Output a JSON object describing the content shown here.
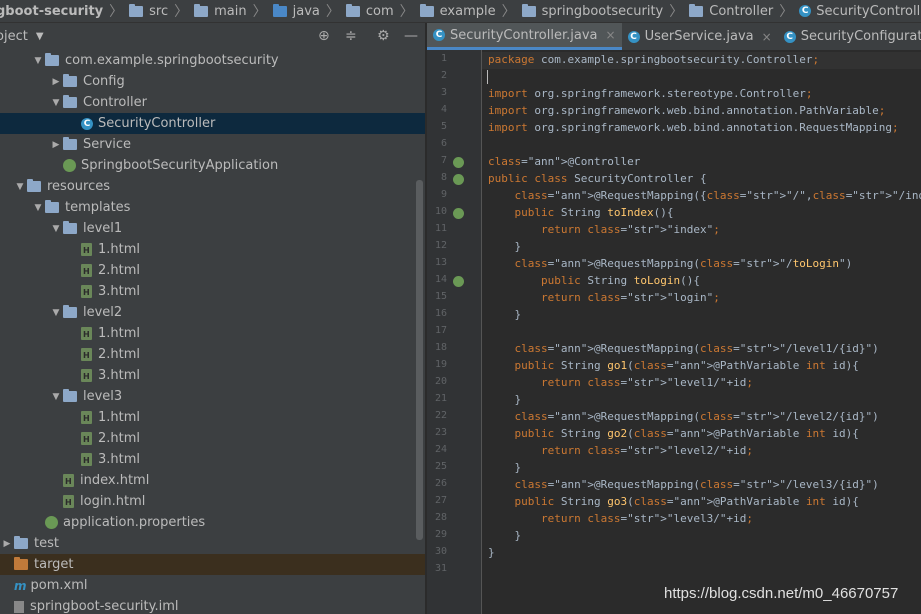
{
  "breadcrumb": {
    "project": "gboot-security",
    "items": [
      "src",
      "main",
      "java",
      "com",
      "example",
      "springbootsecurity",
      "Controller",
      "SecurityController"
    ]
  },
  "project_panel": {
    "title": "oject",
    "tools": [
      "target-icon",
      "collapse-icon",
      "gear-icon",
      "minimize-icon"
    ]
  },
  "tree": [
    {
      "label": "com.example.springbootsecurity",
      "indent": 2,
      "type": "package",
      "expanded": true
    },
    {
      "label": "Config",
      "indent": 3,
      "type": "package",
      "expanded": false
    },
    {
      "label": "Controller",
      "indent": 3,
      "type": "package",
      "expanded": true
    },
    {
      "label": "SecurityController",
      "indent": 4,
      "type": "class",
      "selected": true
    },
    {
      "label": "Service",
      "indent": 3,
      "type": "package",
      "expanded": false
    },
    {
      "label": "SpringbootSecurityApplication",
      "indent": 3,
      "type": "spring"
    },
    {
      "label": "resources",
      "indent": 1,
      "type": "resources",
      "expanded": true
    },
    {
      "label": "templates",
      "indent": 2,
      "type": "folder",
      "expanded": true
    },
    {
      "label": "level1",
      "indent": 3,
      "type": "folder",
      "expanded": true
    },
    {
      "label": "1.html",
      "indent": 4,
      "type": "html"
    },
    {
      "label": "2.html",
      "indent": 4,
      "type": "html"
    },
    {
      "label": "3.html",
      "indent": 4,
      "type": "html"
    },
    {
      "label": "level2",
      "indent": 3,
      "type": "folder",
      "expanded": true
    },
    {
      "label": "1.html",
      "indent": 4,
      "type": "html"
    },
    {
      "label": "2.html",
      "indent": 4,
      "type": "html"
    },
    {
      "label": "3.html",
      "indent": 4,
      "type": "html"
    },
    {
      "label": "level3",
      "indent": 3,
      "type": "folder",
      "expanded": true
    },
    {
      "label": "1.html",
      "indent": 4,
      "type": "html"
    },
    {
      "label": "2.html",
      "indent": 4,
      "type": "html"
    },
    {
      "label": "3.html",
      "indent": 4,
      "type": "html"
    },
    {
      "label": "index.html",
      "indent": 3,
      "type": "html"
    },
    {
      "label": "login.html",
      "indent": 3,
      "type": "html"
    },
    {
      "label": "application.properties",
      "indent": 2,
      "type": "spring"
    },
    {
      "label": "test",
      "indent": 0,
      "type": "folder",
      "expanded": false
    },
    {
      "label": "target",
      "indent": 0,
      "type": "target",
      "excluded": true
    },
    {
      "label": "pom.xml",
      "indent": 0,
      "type": "xml"
    },
    {
      "label": "springboot-security.iml",
      "indent": 0,
      "type": "iml"
    }
  ],
  "tabs": [
    {
      "label": "SecurityController.java",
      "active": true
    },
    {
      "label": "UserService.java",
      "active": false
    },
    {
      "label": "SecurityConfiguration.java",
      "active": false
    }
  ],
  "code_lines": [
    "package com.example.springbootsecurity.Controller;",
    "",
    "import org.springframework.stereotype.Controller;",
    "import org.springframework.web.bind.annotation.PathVariable;",
    "import org.springframework.web.bind.annotation.RequestMapping;",
    "",
    "@Controller",
    "public class SecurityController {",
    "    @RequestMapping({\"/\",\"/index\"})",
    "    public String toIndex(){",
    "        return \"index\";",
    "    }",
    "    @RequestMapping(\"/toLogin\")",
    "        public String toLogin(){",
    "        return \"login\";",
    "    }",
    "",
    "    @RequestMapping(\"/level1/{id}\")",
    "    public String go1(@PathVariable int id){",
    "        return \"level1/\"+id;",
    "    }",
    "    @RequestMapping(\"/level2/{id}\")",
    "    public String go2(@PathVariable int id){",
    "        return \"level2/\"+id;",
    "    }",
    "    @RequestMapping(\"/level3/{id}\")",
    "    public String go3(@PathVariable int id){",
    "        return \"level3/\"+id;",
    "    }",
    "}",
    ""
  ],
  "gutter_icons": [
    7,
    8,
    10,
    14
  ],
  "watermark": "https://blog.csdn.net/m0_46670757",
  "colors": {
    "accent": "#4a88c7",
    "selection": "#0d293e",
    "keyword": "#cc7832",
    "annotation": "#bbb529",
    "string": "#6a8759",
    "method": "#ffc66d"
  }
}
